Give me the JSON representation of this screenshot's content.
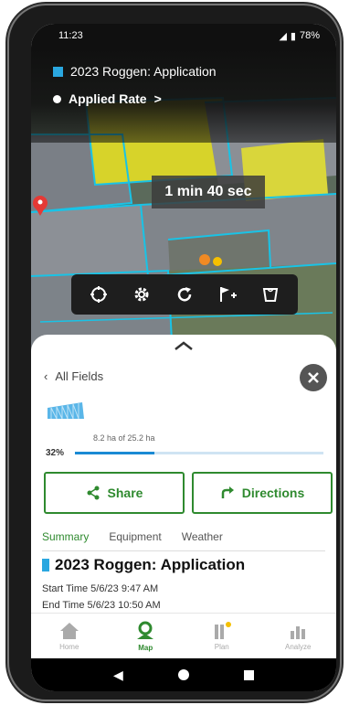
{
  "status_bar": {
    "time": "11:23",
    "battery": "78%"
  },
  "map_header": {
    "title": "2023 Roggen: Application",
    "layer": "Applied Rate",
    "layer_chevron": ">"
  },
  "map": {
    "timer": "1 min 40 sec",
    "marker_color": "#e53935",
    "boundary_color": "#19c3e6"
  },
  "toolbar": {
    "icons": [
      "crosshair-icon",
      "gear-icon",
      "refresh-icon",
      "add-flag-icon",
      "bucket-icon"
    ]
  },
  "sheet": {
    "back_label": "All Fields",
    "progress": {
      "text": "8.2 ha of 25.2 ha",
      "percent_label": "32%",
      "fraction": 0.32
    },
    "share_label": "Share",
    "directions_label": "Directions",
    "tabs": [
      "Summary",
      "Equipment",
      "Weather"
    ],
    "summary": {
      "title": "2023 Roggen: Application",
      "start_time": "Start Time 5/6/23 9:47 AM",
      "end_time": "End Time 5/6/23 10:50 AM"
    }
  },
  "bottom_nav": [
    {
      "label": "Home",
      "icon": "home-icon",
      "active": false
    },
    {
      "label": "Map",
      "icon": "map-pin-icon",
      "active": true
    },
    {
      "label": "Plan",
      "icon": "plan-icon",
      "active": false
    },
    {
      "label": "Analyze",
      "icon": "bar-chart-icon",
      "active": false
    }
  ],
  "colors": {
    "accent": "#2f8a2f",
    "progress": "#1a8ad4",
    "field": "#2aa7e0"
  }
}
